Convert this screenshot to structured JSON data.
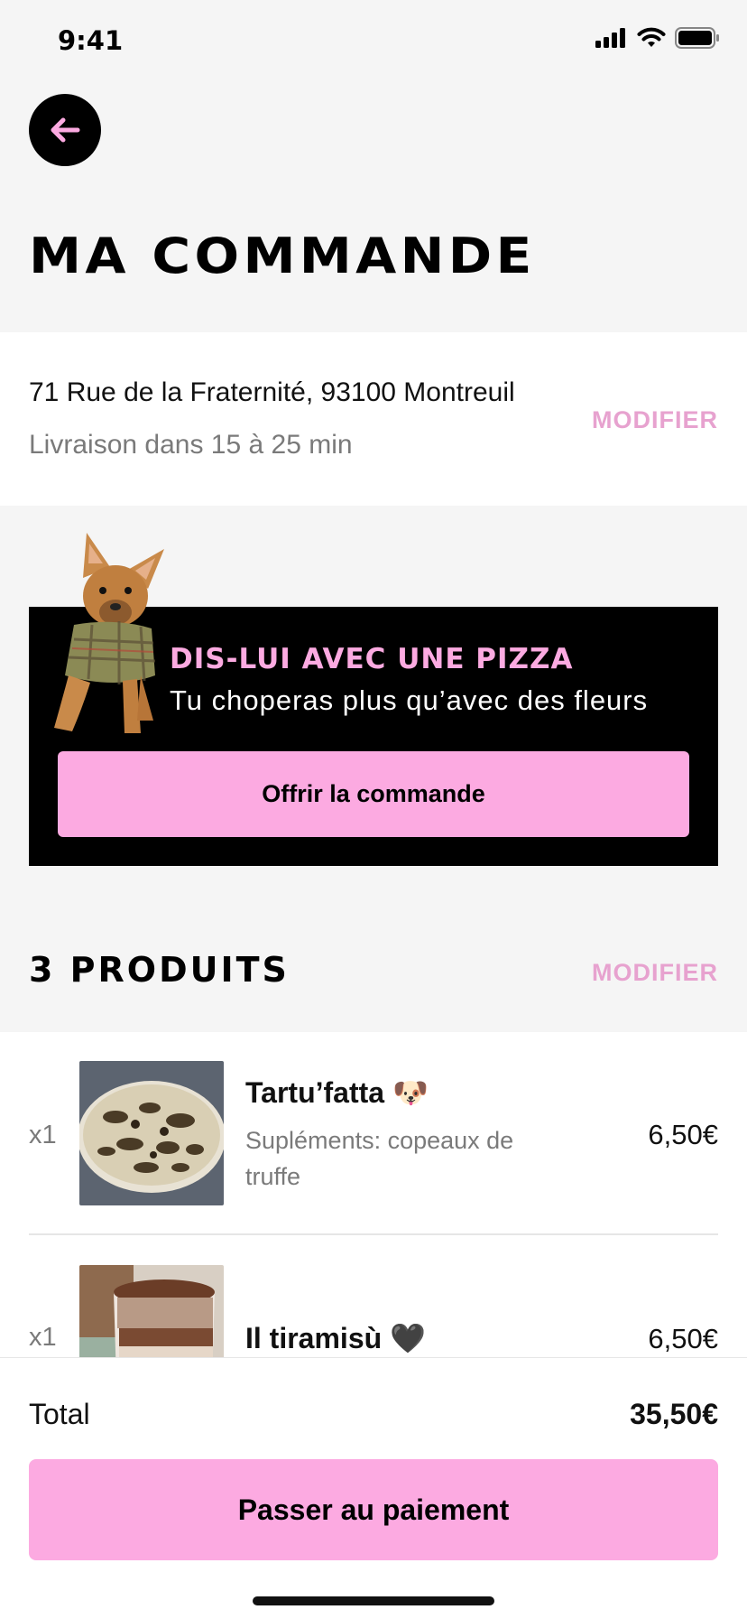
{
  "status_bar": {
    "time": "9:41"
  },
  "header": {
    "title": "MA COMMANDE"
  },
  "delivery": {
    "address": "71 Rue de la Fraternité, 93100 Montreuil",
    "eta": "Livraison dans 15 à 25 min",
    "modify_label": "MODIFIER"
  },
  "promo": {
    "title": "DIS-LUI AVEC UNE PIZZA",
    "subtitle": "Tu choperas plus qu’avec des fleurs",
    "button_label": "Offrir la commande"
  },
  "products": {
    "title": "3 PRODUITS",
    "modify_label": "MODIFIER",
    "items": [
      {
        "qty": "x1",
        "name": "Tartu’fatta 🐶",
        "desc": "Supléments: copeaux de truffe",
        "price": "6,50€"
      },
      {
        "qty": "x1",
        "name": "Il tiramisù 🖤",
        "desc": "",
        "price": "6,50€"
      }
    ]
  },
  "footer": {
    "total_label": "Total",
    "total_value": "35,50€",
    "pay_label": "Passer au paiement"
  },
  "colors": {
    "accent_pink": "#fcaae1",
    "link_pink": "#e7a2cf",
    "background": "#f5f5f5"
  },
  "icons": [
    "back-arrow-icon",
    "signal-icon",
    "wifi-icon",
    "battery-icon"
  ]
}
